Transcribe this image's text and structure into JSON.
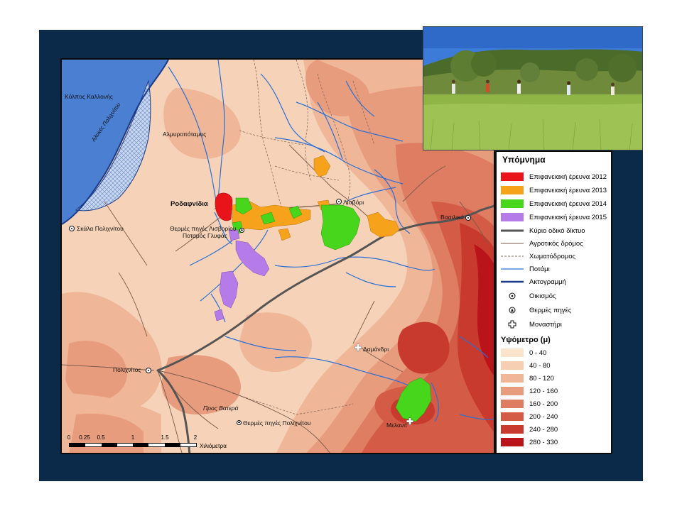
{
  "legend": {
    "title": "Υπόμνημα",
    "items": [
      {
        "label": "Επιφανειακή έρευνα 2012",
        "color": "#e8141a",
        "type": "fill"
      },
      {
        "label": "Επιφανειακή έρευνα 2013",
        "color": "#f6a21a",
        "type": "fill"
      },
      {
        "label": "Επιφανειακή έρευνα 2014",
        "color": "#47d61c",
        "type": "fill"
      },
      {
        "label": "Επιφανειακή έρευνα 2015",
        "color": "#b57be8",
        "type": "fill"
      },
      {
        "label": "Κύριο οδικό δίκτυο",
        "color": "#555555",
        "type": "thick-line"
      },
      {
        "label": "Αγροτικός δρόμος",
        "color": "#7a5a4a",
        "type": "thin-line"
      },
      {
        "label": "Χωματόδρομος",
        "color": "#8a6a5a",
        "type": "dashed-line"
      },
      {
        "label": "Ποτάμι",
        "color": "#2b6fd6",
        "type": "river"
      },
      {
        "label": "Ακτογραμμή",
        "color": "#1a3a8a",
        "type": "coast"
      },
      {
        "label": "Οικισμός",
        "color": "#111111",
        "type": "settlement"
      },
      {
        "label": "Θερμές πηγές",
        "color": "#111111",
        "type": "spring"
      },
      {
        "label": "Μοναστήρι",
        "color": "#111111",
        "type": "monastery"
      }
    ],
    "elevation_title": "Υψόμετρο (μ)",
    "elevation": [
      {
        "label": "0 - 40",
        "color": "#fbe3cc"
      },
      {
        "label": "40 - 80",
        "color": "#f6cfb2"
      },
      {
        "label": "80 - 120",
        "color": "#efb798"
      },
      {
        "label": "120 - 160",
        "color": "#e89c7e"
      },
      {
        "label": "160 - 200",
        "color": "#de7d62"
      },
      {
        "label": "200 - 240",
        "color": "#d45c46"
      },
      {
        "label": "240 - 280",
        "color": "#c83a2e"
      },
      {
        "label": "280 - 330",
        "color": "#b8141a"
      }
    ]
  },
  "map": {
    "labels": {
      "gulf": "Κόλπος Καλλονής",
      "saltpans": "Αλυκές Πολιχνίτου",
      "river": "Αλμυροπόταμος",
      "rodafnidia": "Ροδαφνίδια",
      "skala": "Σκάλα Πολιχνίτου",
      "springs_lisvori_1": "Θερμές πηγές Λισβορίου",
      "springs_lisvori_2": "Ποταμός Γλυφάς",
      "lisvori": "Λισβόρι",
      "vasilika": "Βασιλικά",
      "damandri": "Δαμάνδρι",
      "polichnitos": "Πολιχνίτος",
      "to_vatera": "Προς Βατερά",
      "springs_polichnitos": "Θερμές πηγές Πολιχνίτου",
      "melanta": "Μελανιτ"
    },
    "scale": {
      "ticks": [
        "0",
        "0.25",
        "0.5",
        "1",
        "1.5",
        "2"
      ],
      "unit": "Χιλιόμετρα"
    }
  }
}
